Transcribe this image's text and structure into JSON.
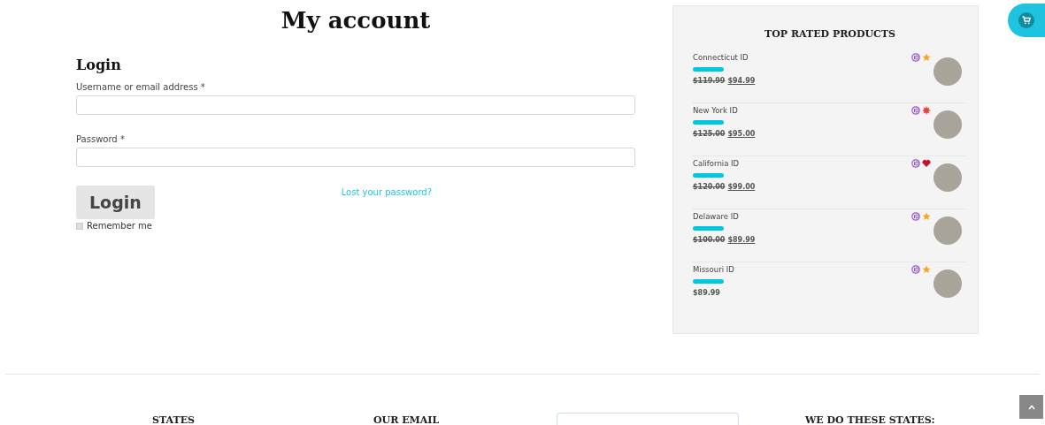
{
  "page_title": "My account",
  "login": {
    "heading": "Login",
    "username_label": "Username or email address *",
    "password_label": "Password *",
    "submit": "Login",
    "lost_password": "Lost your password?",
    "remember": {
      "label": "Remember me",
      "checked": false
    }
  },
  "top_rated": {
    "title": "TOP RATED PRODUCTS",
    "products": [
      {
        "name": "Connecticut ID",
        "old_price": "$119.99",
        "price": "$94.99",
        "kind": "star"
      },
      {
        "name": "New York ID",
        "old_price": "$125.00",
        "price": "$95.00",
        "kind": "burst"
      },
      {
        "name": "California ID",
        "old_price": "$120.00",
        "price": "$99.00",
        "kind": "heart"
      },
      {
        "name": "Delaware ID",
        "old_price": "$100.00",
        "price": "$89.99",
        "kind": "star"
      },
      {
        "name": "Missouri ID",
        "price": "$89.99",
        "kind": "star"
      }
    ]
  },
  "footer": {
    "headings": [
      "STATES",
      "OUR EMAIL",
      "WE DO THESE STATES:"
    ]
  }
}
